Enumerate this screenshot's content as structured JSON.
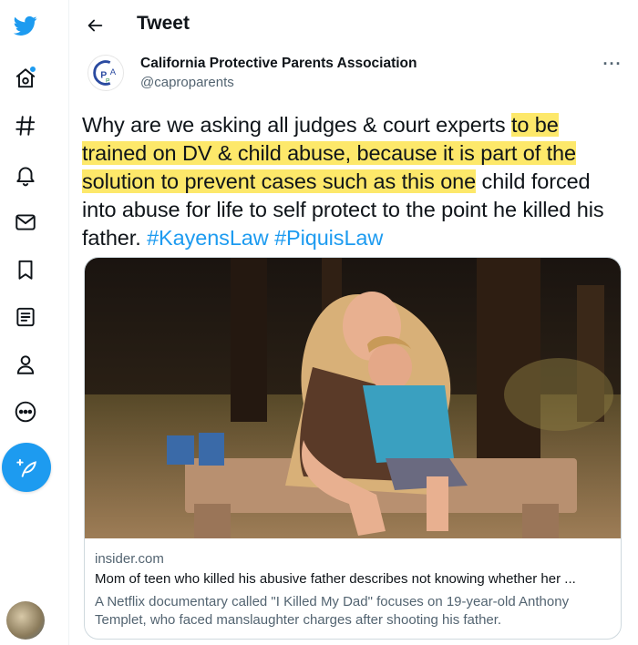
{
  "header": {
    "title": "Tweet"
  },
  "sidebar": {
    "items": [
      {
        "icon": "twitter-logo-icon"
      },
      {
        "icon": "home-icon",
        "has_notification_dot": true
      },
      {
        "icon": "hashtag-icon"
      },
      {
        "icon": "bell-icon"
      },
      {
        "icon": "mail-icon"
      },
      {
        "icon": "bookmark-icon"
      },
      {
        "icon": "list-icon"
      },
      {
        "icon": "profile-icon"
      },
      {
        "icon": "more-circle-icon"
      }
    ],
    "compose_icon": "compose-feather-icon"
  },
  "tweet": {
    "author_name": "California Protective Parents Association",
    "author_handle": "@caproparents",
    "text_part1": "Why are we asking all judges & court experts ",
    "text_highlighted": "to be trained on DV & child abuse, because it is part of the solution to prevent cases such as this one",
    "text_part2": " child forced into abuse for life to self protect to the point he killed his father. ",
    "hashtag1": "#KayensLaw",
    "hashtag2": "#PiquisLaw",
    "more_label": "···"
  },
  "card": {
    "domain": "insider.com",
    "title": "Mom of teen who killed his abusive father describes not knowing whether her ...",
    "description": "A Netflix documentary called \"I Killed My Dad\" focuses on 19-year-old Anthony Templet, who faced manslaughter charges after shooting his father."
  },
  "colors": {
    "accent": "#1d9bf0",
    "highlight": "#fde86a",
    "secondary_text": "#536471"
  }
}
